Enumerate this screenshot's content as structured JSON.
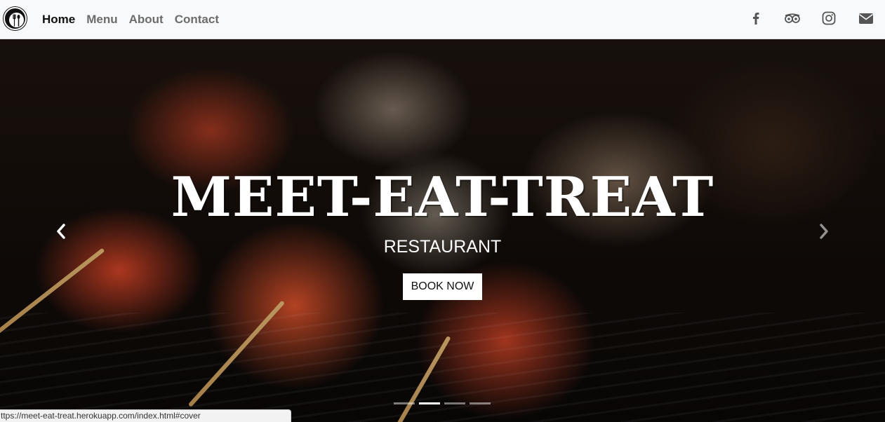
{
  "nav": {
    "logo_icon": "restaurant-logo-icon",
    "links": [
      {
        "label": "Home",
        "active": true
      },
      {
        "label": "Menu",
        "active": false
      },
      {
        "label": "About",
        "active": false
      },
      {
        "label": "Contact",
        "active": false
      }
    ],
    "socials": [
      "facebook-icon",
      "tripadvisor-icon",
      "instagram-icon",
      "envelope-icon"
    ]
  },
  "hero": {
    "title": "MEET-EAT-TREAT",
    "subtitle": "RESTAURANT",
    "button_label": "BOOK NOW",
    "carousel": {
      "slide_count": 4,
      "active_index": 1
    }
  },
  "status_bar": {
    "url": "ttps://meet-eat-treat.herokuapp.com/index.html#cover"
  },
  "colors": {
    "navbar_bg": "#f8f9fa",
    "nav_active": "#111111",
    "nav_inactive": "#6c6c6c",
    "icon_gray": "#555555"
  }
}
